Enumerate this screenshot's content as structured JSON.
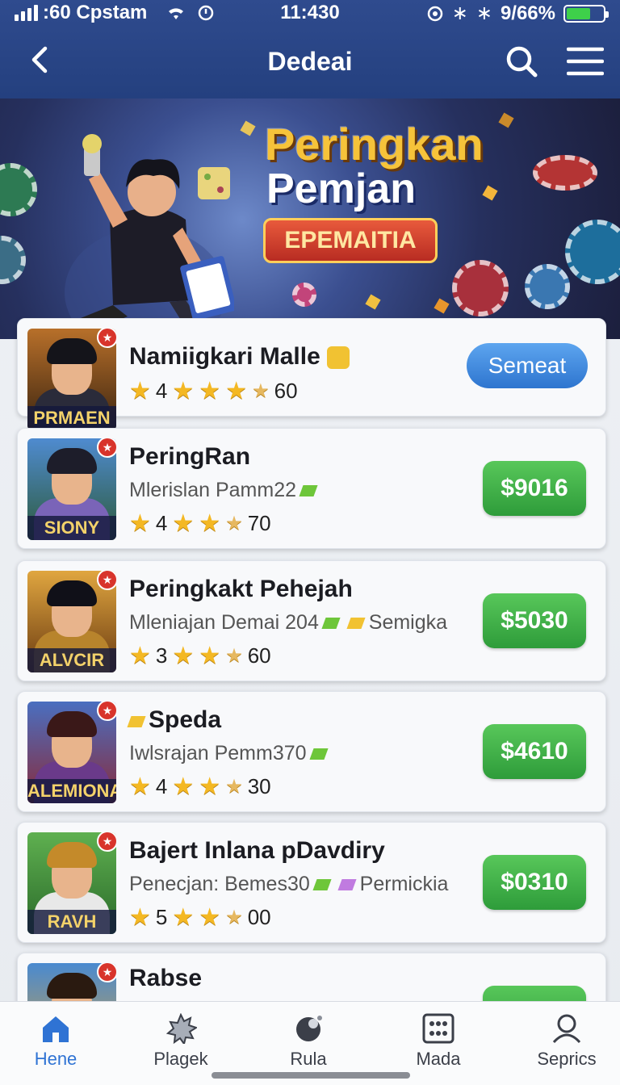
{
  "status_bar": {
    "carrier": ":60 Cpstam",
    "time": "11:430",
    "battery_text": "9/66%",
    "battery_fill": 0.66
  },
  "header": {
    "title": "Dedeai",
    "icons": [
      "back-arrow-icon",
      "search-icon",
      "menu-icon"
    ]
  },
  "banner": {
    "title_line1": "Peringkan",
    "title_line2": "Pemjan",
    "button_label": "EPEMAITIA"
  },
  "colors": {
    "header_bg": "#2f4b8e",
    "price_green": "#3fb24a",
    "button_blue": "#3a86dd",
    "active_nav": "#2f73d4",
    "star": "#f4b823"
  },
  "list": [
    {
      "name": "Namiigkari Malle",
      "tag": "PRMAEN",
      "subtitle": "",
      "rating": "4",
      "rating_extra": "60",
      "stars": 3,
      "action": "Semeat",
      "action_type": "button"
    },
    {
      "name": "PeringRan",
      "tag": "SIONY",
      "subtitle": "Mlerislan Pamm22",
      "rating": "4",
      "rating_extra": "70",
      "stars": 2,
      "action": "$9016",
      "action_type": "price"
    },
    {
      "name": "Peringkakt Pehejah",
      "tag": "ALVCIR",
      "subtitle": "Mleniajan Demai 204",
      "subtitle_extra": "Semigka",
      "rating": "3",
      "rating_extra": "60",
      "stars": 2,
      "action": "$5030",
      "action_type": "price"
    },
    {
      "name": "Speda",
      "tag": "ALEMIONA",
      "subtitle": "Iwlsrajan Pemm370",
      "rating": "4",
      "rating_extra": "30",
      "stars": 2,
      "action": "$4610",
      "action_type": "price"
    },
    {
      "name": "Bajert Inlana pDavdiry",
      "tag": "RAVH",
      "subtitle": "Penecjan: Bemes30",
      "subtitle_extra": "Permickia",
      "rating": "5",
      "rating_extra": "00",
      "stars": 2,
      "action": "$0310",
      "action_type": "price"
    },
    {
      "name": "Rabse",
      "tag": "",
      "subtitle": "",
      "rating": "",
      "rating_extra": "",
      "stars": 0,
      "action": "",
      "action_type": "price"
    }
  ],
  "bottom_nav": [
    {
      "label": "Hene",
      "icon": "home-icon",
      "active": true
    },
    {
      "label": "Plagek",
      "icon": "spiky-ball-icon",
      "active": false
    },
    {
      "label": "Rula",
      "icon": "planet-icon",
      "active": false
    },
    {
      "label": "Mada",
      "icon": "grid-icon",
      "active": false
    },
    {
      "label": "Seprics",
      "icon": "person-icon",
      "active": false
    }
  ]
}
